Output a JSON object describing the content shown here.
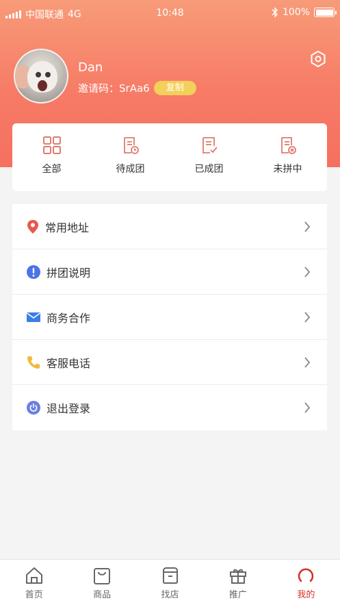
{
  "status_bar": {
    "carrier": "中国联通",
    "network": "4G",
    "time": "10:48",
    "battery": "100%"
  },
  "profile": {
    "username": "Dan",
    "invite_label": "邀请码：",
    "invite_code": "SrAa6",
    "copy_label": "复制"
  },
  "orders": [
    {
      "label": "全部",
      "icon": "grid-icon"
    },
    {
      "label": "待成团",
      "icon": "pending-doc-icon"
    },
    {
      "label": "已成团",
      "icon": "done-doc-icon"
    },
    {
      "label": "未拼中",
      "icon": "failed-doc-icon"
    }
  ],
  "menu": [
    {
      "label": "常用地址",
      "icon": "location-pin-icon"
    },
    {
      "label": "拼团说明",
      "icon": "info-icon"
    },
    {
      "label": "商务合作",
      "icon": "mail-icon"
    },
    {
      "label": "客服电话",
      "icon": "phone-icon"
    },
    {
      "label": "退出登录",
      "icon": "power-icon"
    }
  ],
  "tabs": [
    {
      "label": "首页",
      "icon": "home-icon"
    },
    {
      "label": "商品",
      "icon": "bag-icon"
    },
    {
      "label": "找店",
      "icon": "store-icon"
    },
    {
      "label": "推广",
      "icon": "gift-icon"
    },
    {
      "label": "我的",
      "icon": "profile-icon",
      "active": true
    }
  ],
  "colors": {
    "accent": "#d4342a",
    "header_gradient_top": "#f79b78",
    "header_gradient_bottom": "#f6705f",
    "copy_button": "#f3d05a",
    "order_icon": "#e07a6d"
  }
}
